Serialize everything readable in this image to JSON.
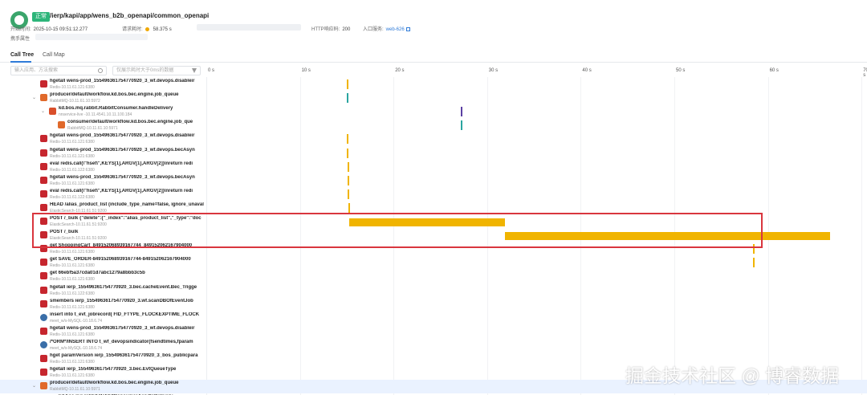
{
  "header": {
    "badge": "正常",
    "title": "/ierp/kapi/app/wens_b2b_openapi/common_openapi",
    "start_label": "开始时间:",
    "start_value": "2025-10-15 09:51:12.277",
    "duration_label": "请求耗时:",
    "duration_value": "58.375 s",
    "status_label": "HTTP响应码:",
    "status_value": "200",
    "entry_label": "入口服务:",
    "entry_value": "web-626",
    "attr_label": "携手属性"
  },
  "tabs": [
    {
      "label": "Call Tree",
      "active": true
    },
    {
      "label": "Call Map",
      "active": false
    }
  ],
  "toolbar": {
    "search_placeholder": "输入应用、方法搜索",
    "filter_placeholder": "仅展示耗时大于0ms的数据",
    "ticks": [
      "0 s",
      "10 s",
      "20 s",
      "30 s",
      "40 s",
      "50 s",
      "60 s",
      "70 s"
    ]
  },
  "rows": [
    {
      "icon": "redis",
      "indent": 0,
      "title": "hgetall wens-prod_155496361754770920_3_wf.devops.disableir",
      "sub": "Redis-10.11.61.121:6380"
    },
    {
      "icon": "mq",
      "indent": 0,
      "chevron": "⌄",
      "title": "producer/default/workflow.kd.bos.bec.engine.job_queue",
      "sub": "RabbitMQ-10.11.61.10:5972"
    },
    {
      "icon": "kd",
      "indent": 1,
      "chevron": "⌄",
      "title": "kd.bos.mq.rabbit.RabbitConsumer.handleDelivery",
      "sub": "nnservice-live  -10.11.4541.10.11.100.184"
    },
    {
      "icon": "mq",
      "indent": 2,
      "title": "consumer/default/workflow.kd.bos.bec.engine.job_que",
      "sub": "RabbitMQ-10.11.61.10:5971"
    },
    {
      "icon": "redis",
      "indent": 0,
      "title": "hgetall wens-prod_155496361754770920_3_wf.devops.disableir",
      "sub": "Redis-10.11.61.121:6380"
    },
    {
      "icon": "redis",
      "indent": 0,
      "title": "hgetall wens-prod_155496361754770920_3_wf.devops.becAsyn",
      "sub": "Redis-10.11.61.121:6380"
    },
    {
      "icon": "redis",
      "indent": 0,
      "title": "eval redis.call(\\\"hset\\\",KEYS[1],ARGV[1],ARGV[2])\\nreturn redi",
      "sub": "Redis-10.11.61.122:6380"
    },
    {
      "icon": "redis",
      "indent": 0,
      "title": "hgetall wens-prod_155496361754770920_3_wf.devops.becAsyn",
      "sub": "Redis-10.11.61.121:6380"
    },
    {
      "icon": "redis",
      "indent": 0,
      "title": "eval redis.call(\\\"hset\\\",KEYS[1],ARGV[1],ARGV[2])\\nreturn redi",
      "sub": "Redis-10.11.61.122:6380"
    },
    {
      "icon": "es",
      "indent": 0,
      "title": "HEAD /alias_product_list (include_type_name=false, ignore_unaval",
      "sub": "ElasticSearch-10.11.61.51:9200"
    },
    {
      "icon": "es",
      "indent": 0,
      "title": "POST /_bulk {\"delete\":{\"_index\":\"alias_product_list\",\"_type\":\"doc",
      "sub": "ElasticSearch-10.11.61.51:9200"
    },
    {
      "icon": "es",
      "indent": 0,
      "title": "POST /_bulk",
      "sub": "ElasticSearch-10.11.61.51:9200"
    },
    {
      "icon": "redis",
      "indent": 0,
      "title": "get ShoppingCart_849152068939167744_849152062167904000",
      "sub": "Redis-10.11.61.121:6380"
    },
    {
      "icon": "redis",
      "indent": 0,
      "title": "get SAVE_ORDER-849152068939167744-849152062167904000",
      "sub": "Redis-10.11.61.121:6380"
    },
    {
      "icon": "redis",
      "indent": 0,
      "title": "get 66ebf5a37cda01d7abc1279a8bbb3c5b",
      "sub": "Redis-10.11.61.121:6380"
    },
    {
      "icon": "redis",
      "indent": 0,
      "title": "hgetall ierp_155496361754770920_3.bec.cacheEvent.Bec_Trigge",
      "sub": "Redis-10.11.61.122:6380"
    },
    {
      "icon": "redis",
      "indent": 0,
      "title": "smembers ierp_155496361754770920_3.wf.scanDBOfEventJob",
      "sub": "Redis-10.11.61.121:6380"
    },
    {
      "icon": "mysql",
      "indent": 0,
      "title": "insert into t_evt_jobrecord( FID_FTYPE_FLOCKEXPTIME_FLOCK",
      "sub": "meet_w/s-MySQL-10.18.6.74"
    },
    {
      "icon": "redis",
      "indent": 0,
      "title": "hgetall wens-prod_155496361754770920_3_wf.devops.disableir",
      "sub": "Redis-10.11.61.121:6380"
    },
    {
      "icon": "mysql",
      "indent": 0,
      "title": "/*ORM*/INSERT INTO t_wf_devopsindicator(fsendtimes,fparam",
      "sub": "meet_w/s-MySQL-10.18.6.74"
    },
    {
      "icon": "redis",
      "indent": 0,
      "title": "hget paramVersion ierp_155496361754770920_3_bos_publicpara",
      "sub": "Redis-10.11.61.121:6380"
    },
    {
      "icon": "redis",
      "indent": 0,
      "title": "hgetall ierp_155496361754770920_3.bec.EvtQueueType",
      "sub": "Redis-10.11.61.121:6380"
    },
    {
      "icon": "mq",
      "indent": 0,
      "chevron": "⌄",
      "title": "producer/default/workflow.kd.bos.bec.engine.job_queue",
      "sub": "RabbitMQ-10.11.61.10:5971",
      "highlight": true
    },
    {
      "icon": "kd",
      "indent": 1,
      "title": "kd.bos.mq.rabbit.RabbitConsumer.handleDelivery",
      "sub": ""
    }
  ],
  "timeline": {
    "bars": [
      {
        "row": 0,
        "start_s": 14.8,
        "dur_s": 0.15,
        "color": "#f0b400"
      },
      {
        "row": 1,
        "start_s": 14.8,
        "dur_s": 0.15,
        "color": "#2aa5a0"
      },
      {
        "row": 2,
        "start_s": 27.0,
        "dur_s": 0.15,
        "color": "#5b3fa3"
      },
      {
        "row": 3,
        "start_s": 27.0,
        "dur_s": 0.15,
        "color": "#2aa5a0"
      },
      {
        "row": 4,
        "start_s": 14.8,
        "dur_s": 0.15,
        "color": "#f0b400"
      },
      {
        "row": 5,
        "start_s": 14.8,
        "dur_s": 0.15,
        "color": "#f0b400"
      },
      {
        "row": 6,
        "start_s": 14.9,
        "dur_s": 0.15,
        "color": "#f0b400"
      },
      {
        "row": 7,
        "start_s": 14.9,
        "dur_s": 0.15,
        "color": "#f0b400"
      },
      {
        "row": 8,
        "start_s": 14.9,
        "dur_s": 0.15,
        "color": "#f0b400"
      },
      {
        "row": 9,
        "start_s": 15.0,
        "dur_s": 0.2,
        "color": "#f0b400"
      },
      {
        "row": 10,
        "start_s": 15.1,
        "dur_s": 16.6,
        "color": "#f0b400"
      },
      {
        "row": 11,
        "start_s": 31.7,
        "dur_s": 34.8,
        "color": "#f0b400"
      },
      {
        "row": 12,
        "start_s": 58.2,
        "dur_s": 0.15,
        "color": "#f0b400"
      },
      {
        "row": 13,
        "start_s": 58.2,
        "dur_s": 0.15,
        "color": "#f0b400"
      }
    ]
  },
  "watermark": "掘金技术社区 @ 博睿数据"
}
